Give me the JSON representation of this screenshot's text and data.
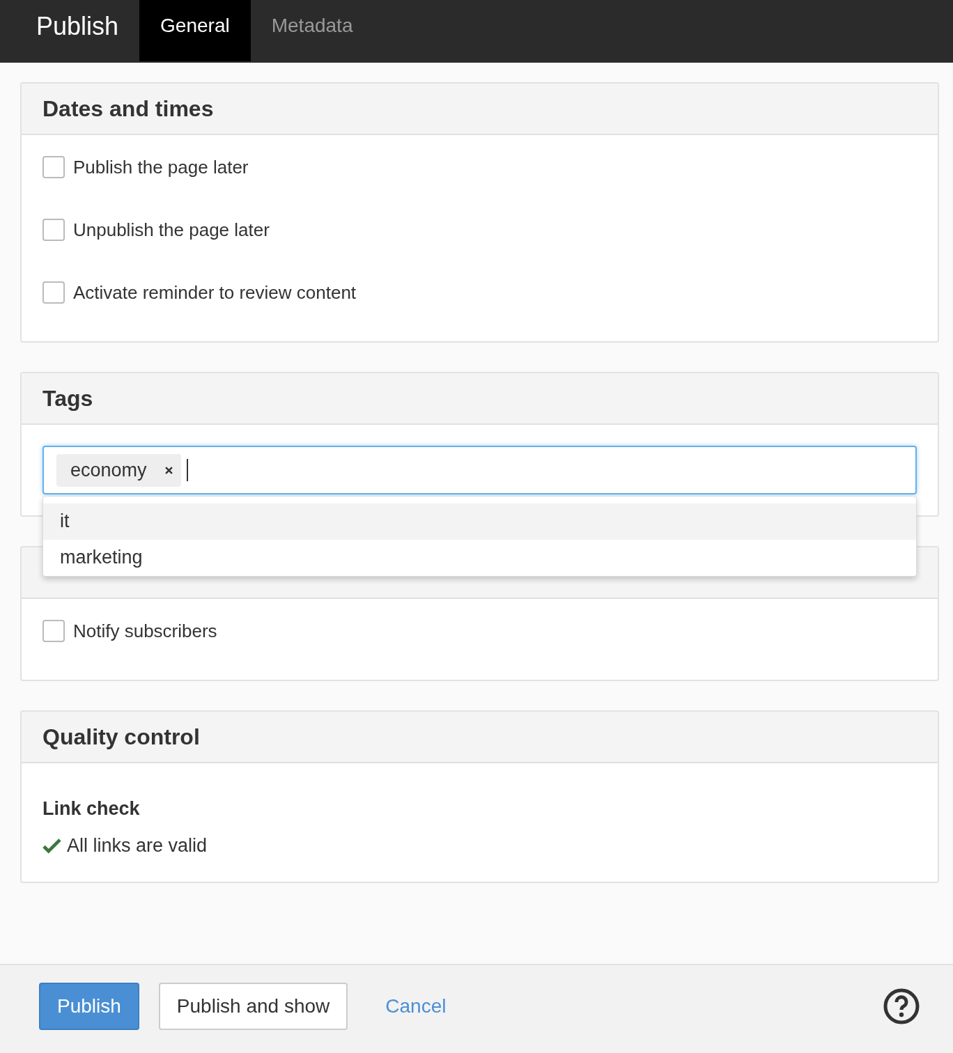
{
  "topbar": {
    "title": "Publish",
    "tabs": [
      {
        "label": "General",
        "selected": true
      },
      {
        "label": "Metadata",
        "selected": false
      }
    ]
  },
  "panels": [
    {
      "kind": "checks",
      "heading": "Dates and times",
      "items": [
        {
          "label": "Publish the page later",
          "checked": false
        },
        {
          "label": "Unpublish the page later",
          "checked": false
        },
        {
          "label": "Activate reminder to review content",
          "checked": false
        }
      ]
    },
    {
      "kind": "tags",
      "heading": "Tags",
      "tags": [
        "economy"
      ],
      "suggestions": [
        {
          "label": "it",
          "selected": true
        },
        {
          "label": "marketing",
          "selected": false
        }
      ]
    },
    {
      "kind": "checks",
      "items": [
        {
          "label": "Notify subscribers",
          "checked": false
        }
      ]
    },
    {
      "kind": "quality",
      "heading": "Quality control",
      "subheading": "Link check",
      "status": "All links are valid"
    }
  ],
  "footer": {
    "primary": "Publish",
    "secondary": "Publish and show",
    "cancel": "Cancel"
  }
}
